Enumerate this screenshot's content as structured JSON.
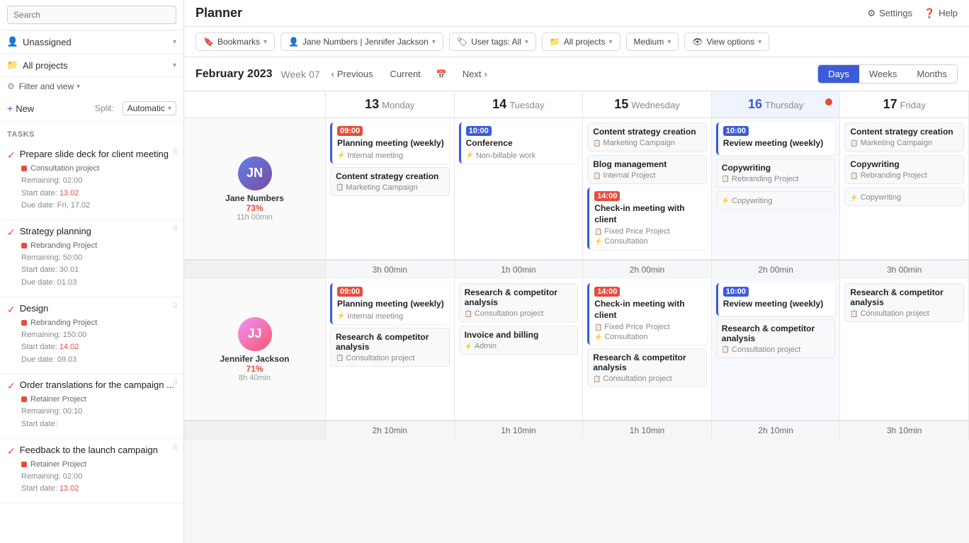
{
  "app": {
    "title": "Planner",
    "settings_label": "Settings",
    "help_label": "Help"
  },
  "sidebar": {
    "search_placeholder": "Search",
    "unassigned_label": "Unassigned",
    "all_projects_label": "All projects",
    "filter_label": "Filter and view",
    "new_label": "New",
    "split_label": "Split:",
    "split_value": "Automatic",
    "tasks_label": "Tasks",
    "tasks": [
      {
        "title": "Prepare slide deck for client meeting",
        "project": "Consultation project",
        "remaining": "Remaining: 02:00",
        "start": "Start date: 13.02",
        "due": "Due date: Fri, 17.02",
        "start_highlight": "13.02"
      },
      {
        "title": "Strategy planning",
        "project": "Rebranding Project",
        "remaining": "Remaining: 50:00",
        "start": "Start date: 30.01",
        "due": "Due date: 01.03",
        "start_highlight": null
      },
      {
        "title": "Design",
        "project": "Rebranding Project",
        "remaining": "Remaining: 150:00",
        "start": "Start date: 14.02",
        "due": "Due date: 09.03",
        "start_highlight": "14.02"
      },
      {
        "title": "Order translations for the campaign ...",
        "project": "Retainer Project",
        "remaining": "Remaining: 00:10",
        "start": "Start date:",
        "due": "",
        "start_highlight": null
      },
      {
        "title": "Feedback to the launch campaign",
        "project": "Retainer Project",
        "remaining": "Remaining: 02:00",
        "start": "Start date: 13.02",
        "due": "",
        "start_highlight": "13.02"
      }
    ]
  },
  "toolbar": {
    "bookmarks_label": "Bookmarks",
    "user_label": "Jane Numbers | Jennifer Jackson",
    "user_tags_label": "User tags: All",
    "projects_label": "All projects",
    "medium_label": "Medium",
    "view_options_label": "View options"
  },
  "cal_nav": {
    "title": "February 2023",
    "week": "Week 07",
    "previous": "Previous",
    "current": "Current",
    "next": "Next",
    "view_days": "Days",
    "view_weeks": "Weeks",
    "view_months": "Months"
  },
  "columns": [
    {
      "num": "13",
      "name": "Monday",
      "today": false
    },
    {
      "num": "14",
      "name": "Tuesday",
      "today": false
    },
    {
      "num": "15",
      "name": "Wednesday",
      "today": false
    },
    {
      "num": "16",
      "name": "Thursday",
      "today": true
    },
    {
      "num": "17",
      "name": "Friday",
      "today": false
    }
  ],
  "rows": [
    {
      "person": {
        "name": "Jane Numbers",
        "percent": "73%",
        "time": "11h 00min",
        "avatar_type": "jn",
        "initials": "JN"
      },
      "cells": [
        {
          "events": [
            {
              "type": "timed",
              "time": "09:00",
              "time_color": "red",
              "title": "Planning meeting (weekly)",
              "subs": [
                {
                  "icon": "⚡",
                  "text": "Internal meeting"
                }
              ]
            },
            {
              "type": "block",
              "title": "Content strategy creation",
              "subs": [
                {
                  "icon": "📋",
                  "text": "Marketing Campaign"
                }
              ]
            }
          ]
        },
        {
          "events": [
            {
              "type": "timed",
              "time": "10:00",
              "time_color": "blue",
              "title": "Conference",
              "subs": [
                {
                  "icon": "⚡",
                  "text": "Non-billable work"
                }
              ]
            }
          ]
        },
        {
          "events": [
            {
              "type": "block",
              "title": "Content strategy creation",
              "subs": [
                {
                  "icon": "📋",
                  "text": "Marketing Campaign"
                }
              ]
            },
            {
              "type": "block",
              "title": "Blog management",
              "subs": [
                {
                  "icon": "📋",
                  "text": "Internal Project"
                }
              ]
            },
            {
              "type": "timed",
              "time": "14:00",
              "time_color": "red",
              "title": "Check-in meeting with client",
              "subs": [
                {
                  "icon": "📋",
                  "text": "Fixed Price Project"
                },
                {
                  "icon": "⚡",
                  "text": "Consultation"
                }
              ]
            }
          ]
        },
        {
          "events": [
            {
              "type": "timed",
              "time": "10:00",
              "time_color": "blue",
              "title": "Review meeting (weekly)",
              "subs": []
            },
            {
              "type": "block",
              "title": "Copywriting",
              "subs": [
                {
                  "icon": "📋",
                  "text": "Rebranding Project"
                }
              ]
            },
            {
              "type": "block",
              "title": "",
              "subs": [
                {
                  "icon": "⚡",
                  "text": "Copywriting"
                }
              ]
            }
          ]
        },
        {
          "events": [
            {
              "type": "block",
              "title": "Content strategy creation",
              "subs": [
                {
                  "icon": "📋",
                  "text": "Marketing Campaign"
                }
              ]
            },
            {
              "type": "block",
              "title": "Copywriting",
              "subs": [
                {
                  "icon": "📋",
                  "text": "Rebranding Project"
                }
              ]
            },
            {
              "type": "block",
              "title": "",
              "subs": [
                {
                  "icon": "⚡",
                  "text": "Copywriting"
                }
              ]
            }
          ]
        }
      ],
      "footer": [
        "3h 00min",
        "1h 00min",
        "2h 00min",
        "2h 00min",
        "3h 00min"
      ]
    },
    {
      "person": {
        "name": "Jennifer Jackson",
        "percent": "71%",
        "time": "8h 40min",
        "avatar_type": "jj",
        "initials": "JJ"
      },
      "cells": [
        {
          "events": [
            {
              "type": "timed",
              "time": "09:00",
              "time_color": "red",
              "title": "Planning meeting (weekly)",
              "subs": [
                {
                  "icon": "⚡",
                  "text": "Internal meeting"
                }
              ]
            },
            {
              "type": "block",
              "title": "Research & competitor analysis",
              "subs": [
                {
                  "icon": "📋",
                  "text": "Consultation project"
                }
              ]
            }
          ]
        },
        {
          "events": [
            {
              "type": "block",
              "title": "Research & competitor analysis",
              "subs": [
                {
                  "icon": "📋",
                  "text": "Consultation project"
                }
              ]
            },
            {
              "type": "block",
              "title": "Invoice and billing",
              "subs": [
                {
                  "icon": "⚡",
                  "text": "Admin"
                }
              ]
            }
          ]
        },
        {
          "events": [
            {
              "type": "timed",
              "time": "14:00",
              "time_color": "red",
              "title": "Check-in meeting with client",
              "subs": [
                {
                  "icon": "📋",
                  "text": "Fixed Price Project"
                },
                {
                  "icon": "⚡",
                  "text": "Consultation"
                }
              ]
            },
            {
              "type": "block",
              "title": "Research & competitor analysis",
              "subs": [
                {
                  "icon": "📋",
                  "text": "Consultation project"
                }
              ]
            }
          ]
        },
        {
          "events": [
            {
              "type": "timed",
              "time": "10:00",
              "time_color": "blue",
              "title": "Review meeting (weekly)",
              "subs": []
            },
            {
              "type": "block",
              "title": "Research & competitor analysis",
              "subs": [
                {
                  "icon": "📋",
                  "text": "Consultation project"
                }
              ]
            }
          ]
        },
        {
          "events": [
            {
              "type": "block",
              "title": "Research & competitor analysis",
              "subs": [
                {
                  "icon": "📋",
                  "text": "Consultation project"
                }
              ]
            }
          ]
        }
      ],
      "footer": [
        "2h 10min",
        "1h 10min",
        "1h 10min",
        "2h 10min",
        "3h 10min"
      ]
    }
  ]
}
